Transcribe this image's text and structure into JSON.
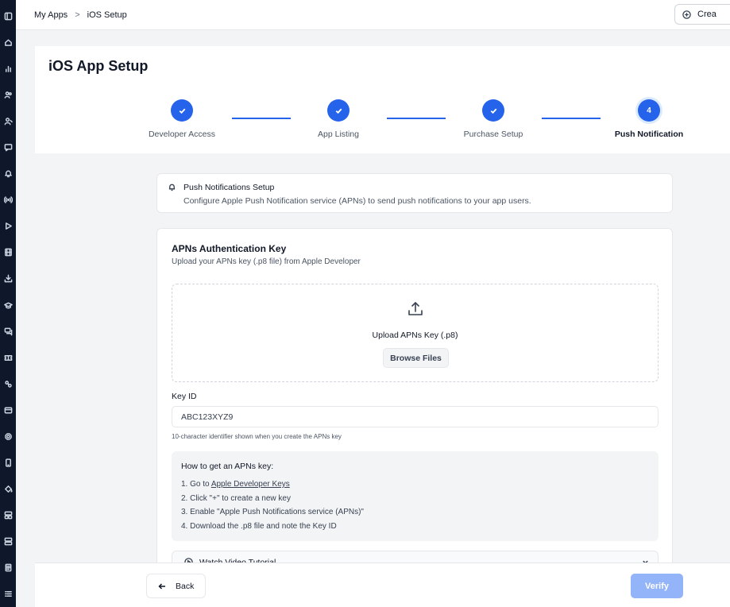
{
  "breadcrumb": {
    "root": "My Apps",
    "separator": ">",
    "current": "iOS Setup"
  },
  "topbar": {
    "create_label": "Crea"
  },
  "page": {
    "title": "iOS App Setup"
  },
  "stepper": {
    "accent_color": "#2563eb",
    "steps": [
      {
        "label": "Developer Access",
        "status": "complete"
      },
      {
        "label": "App Listing",
        "status": "complete"
      },
      {
        "label": "Purchase Setup",
        "status": "complete"
      },
      {
        "label": "Push Notification",
        "status": "active",
        "number": "4"
      }
    ]
  },
  "info": {
    "title": "Push Notifications Setup",
    "description": "Configure Apple Push Notification service (APNs) to send push notifications to your app users."
  },
  "apns": {
    "title": "APNs Authentication Key",
    "subtitle": "Upload your APNs key (.p8 file) from Apple Developer",
    "upload_label": "Upload APNs Key (.p8)",
    "browse_label": "Browse Files",
    "key_id_label": "Key ID",
    "key_id_value": "ABC123XYZ9",
    "key_id_help": "10-character identifier shown when you create the APNs key"
  },
  "howto": {
    "title": "How to get an APNs key:",
    "step1_prefix": "1. Go to ",
    "step1_link": "Apple Developer Keys",
    "step2": "2. Click \"+\" to create a new key",
    "step3": "3. Enable \"Apple Push Notifications service (APNs)\"",
    "step4": "4. Download the .p8 file and note the Key ID"
  },
  "video": {
    "label": "Watch Video Tutorial"
  },
  "footer": {
    "back_label": "Back",
    "verify_label": "Verify"
  },
  "rail_icons": [
    "panel-icon",
    "home-icon",
    "analytics-icon",
    "users-icon",
    "user-icon",
    "chat-icon",
    "bell-icon",
    "broadcast-icon",
    "play-icon",
    "film-icon",
    "download-icon",
    "graduation-icon",
    "messages-icon",
    "ticket-icon",
    "integrations-icon",
    "card-icon",
    "settings-icon",
    "mobile-icon",
    "paint-icon",
    "layout-icon",
    "grid-icon",
    "document-icon",
    "list-icon"
  ]
}
